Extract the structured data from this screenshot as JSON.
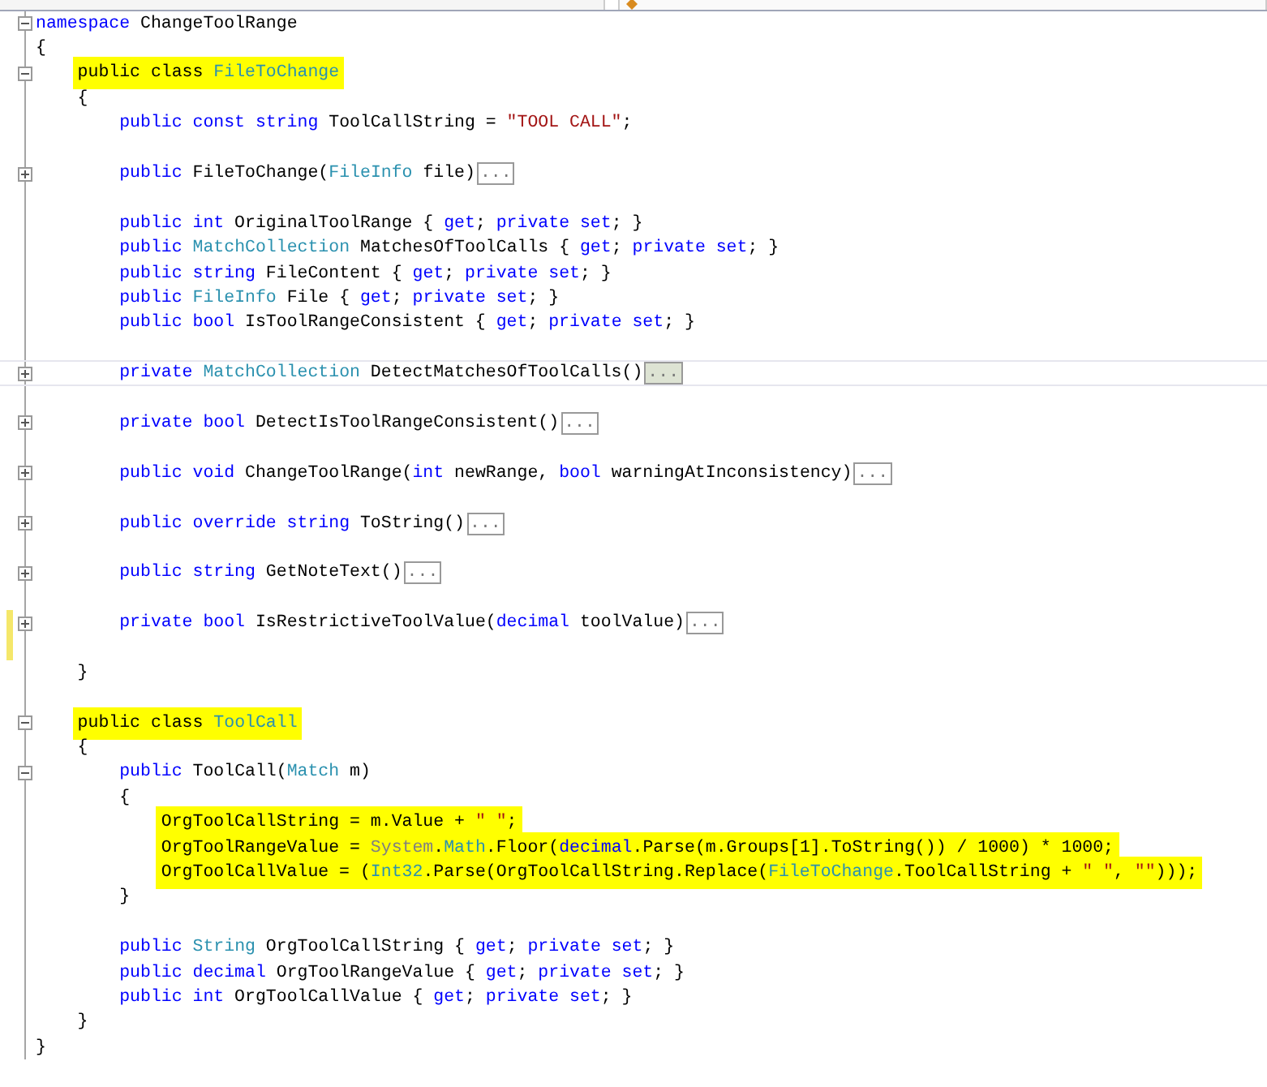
{
  "tabs": [
    {
      "selected": false
    },
    {
      "selected": true
    }
  ],
  "lines": [
    {
      "kind": "code",
      "expanded": true,
      "tokens": [
        {
          "kind": "keyword",
          "text": "namespace"
        },
        {
          "kind": "plain",
          "text": " ChangeToolRange"
        }
      ]
    },
    {
      "kind": "code",
      "tokens": [
        {
          "kind": "plain",
          "text": "{"
        }
      ],
      "children": [
        {
          "kind": "code",
          "expanded": true,
          "highlighted": true,
          "tokens": [
            {
              "kind": "plain",
              "text": "public class "
            },
            {
              "kind": "type",
              "text": "FileToChange"
            }
          ]
        },
        {
          "kind": "code",
          "tokens": [
            {
              "kind": "plain",
              "text": "{"
            }
          ],
          "children": [
            {
              "kind": "code",
              "tokens": [
                {
                  "kind": "keyword",
                  "text": "public const string"
                },
                {
                  "kind": "plain",
                  "text": " ToolCallString = "
                },
                {
                  "kind": "string",
                  "text": "\"TOOL CALL\""
                },
                {
                  "kind": "plain",
                  "text": ";"
                }
              ]
            },
            {
              "kind": "blank"
            },
            {
              "kind": "code",
              "expanded": false,
              "collapsed_text": "...",
              "tokens": [
                {
                  "kind": "keyword",
                  "text": "public"
                },
                {
                  "kind": "plain",
                  "text": " FileToChange("
                },
                {
                  "kind": "type",
                  "text": "FileInfo"
                },
                {
                  "kind": "plain",
                  "text": " file)"
                }
              ]
            },
            {
              "kind": "blank"
            },
            {
              "kind": "code",
              "tokens": [
                {
                  "kind": "keyword",
                  "text": "public int"
                },
                {
                  "kind": "plain",
                  "text": " OriginalToolRange { "
                },
                {
                  "kind": "keyword",
                  "text": "get"
                },
                {
                  "kind": "plain",
                  "text": "; "
                },
                {
                  "kind": "keyword",
                  "text": "private set"
                },
                {
                  "kind": "plain",
                  "text": "; }"
                }
              ]
            },
            {
              "kind": "code",
              "tokens": [
                {
                  "kind": "keyword",
                  "text": "public "
                },
                {
                  "kind": "type",
                  "text": "MatchCollection"
                },
                {
                  "kind": "plain",
                  "text": " MatchesOfToolCalls { "
                },
                {
                  "kind": "keyword",
                  "text": "get"
                },
                {
                  "kind": "plain",
                  "text": "; "
                },
                {
                  "kind": "keyword",
                  "text": "private set"
                },
                {
                  "kind": "plain",
                  "text": "; }"
                }
              ]
            },
            {
              "kind": "code",
              "tokens": [
                {
                  "kind": "keyword",
                  "text": "public string"
                },
                {
                  "kind": "plain",
                  "text": " FileContent { "
                },
                {
                  "kind": "keyword",
                  "text": "get"
                },
                {
                  "kind": "plain",
                  "text": "; "
                },
                {
                  "kind": "keyword",
                  "text": "private set"
                },
                {
                  "kind": "plain",
                  "text": "; }"
                }
              ]
            },
            {
              "kind": "code",
              "tokens": [
                {
                  "kind": "keyword",
                  "text": "public "
                },
                {
                  "kind": "type",
                  "text": "FileInfo"
                },
                {
                  "kind": "plain",
                  "text": " File { "
                },
                {
                  "kind": "keyword",
                  "text": "get"
                },
                {
                  "kind": "plain",
                  "text": "; "
                },
                {
                  "kind": "keyword",
                  "text": "private set"
                },
                {
                  "kind": "plain",
                  "text": "; }"
                }
              ]
            },
            {
              "kind": "code",
              "tokens": [
                {
                  "kind": "keyword",
                  "text": "public bool"
                },
                {
                  "kind": "plain",
                  "text": " IsToolRangeConsistent { "
                },
                {
                  "kind": "keyword",
                  "text": "get"
                },
                {
                  "kind": "plain",
                  "text": "; "
                },
                {
                  "kind": "keyword",
                  "text": "private set"
                },
                {
                  "kind": "plain",
                  "text": "; }"
                }
              ]
            },
            {
              "kind": "blank"
            },
            {
              "kind": "code",
              "expanded": false,
              "current": true,
              "collapsed_text": "...",
              "tokens": [
                {
                  "kind": "keyword",
                  "text": "private "
                },
                {
                  "kind": "type",
                  "text": "MatchCollection"
                },
                {
                  "kind": "plain",
                  "text": " DetectMatchesOfToolCalls()"
                }
              ]
            },
            {
              "kind": "blank"
            },
            {
              "kind": "code",
              "expanded": false,
              "collapsed_text": "...",
              "tokens": [
                {
                  "kind": "keyword",
                  "text": "private bool"
                },
                {
                  "kind": "plain",
                  "text": " DetectIsToolRangeConsistent()"
                }
              ]
            },
            {
              "kind": "blank"
            },
            {
              "kind": "code",
              "expanded": false,
              "collapsed_text": "...",
              "tokens": [
                {
                  "kind": "keyword",
                  "text": "public void"
                },
                {
                  "kind": "plain",
                  "text": " ChangeToolRange("
                },
                {
                  "kind": "keyword",
                  "text": "int"
                },
                {
                  "kind": "plain",
                  "text": " newRange, "
                },
                {
                  "kind": "keyword",
                  "text": "bool"
                },
                {
                  "kind": "plain",
                  "text": " warningAtInconsistency)"
                }
              ]
            },
            {
              "kind": "blank"
            },
            {
              "kind": "code",
              "expanded": false,
              "collapsed_text": "...",
              "tokens": [
                {
                  "kind": "keyword",
                  "text": "public override string"
                },
                {
                  "kind": "plain",
                  "text": " ToString()"
                }
              ]
            },
            {
              "kind": "blank"
            },
            {
              "kind": "code",
              "expanded": false,
              "collapsed_text": "...",
              "tokens": [
                {
                  "kind": "keyword",
                  "text": "public string"
                },
                {
                  "kind": "plain",
                  "text": " GetNoteText()"
                }
              ]
            },
            {
              "kind": "blank"
            },
            {
              "kind": "code",
              "expanded": false,
              "changed": true,
              "collapsed_text": "...",
              "tokens": [
                {
                  "kind": "keyword",
                  "text": "private bool"
                },
                {
                  "kind": "plain",
                  "text": " IsRestrictiveToolValue("
                },
                {
                  "kind": "keyword",
                  "text": "decimal"
                },
                {
                  "kind": "plain",
                  "text": " toolValue)"
                }
              ]
            },
            {
              "kind": "blank",
              "changed": true
            }
          ]
        },
        {
          "kind": "code",
          "tokens": [
            {
              "kind": "plain",
              "text": "}"
            }
          ]
        },
        {
          "kind": "blank"
        },
        {
          "kind": "code",
          "expanded": true,
          "highlighted": true,
          "tokens": [
            {
              "kind": "plain",
              "text": "public class "
            },
            {
              "kind": "type",
              "text": "ToolCall"
            }
          ]
        },
        {
          "kind": "code",
          "tokens": [
            {
              "kind": "plain",
              "text": "{"
            }
          ],
          "children": [
            {
              "kind": "code",
              "expanded": true,
              "tokens": [
                {
                  "kind": "keyword",
                  "text": "public"
                },
                {
                  "kind": "plain",
                  "text": " ToolCall("
                },
                {
                  "kind": "type",
                  "text": "Match"
                },
                {
                  "kind": "plain",
                  "text": " m)"
                }
              ]
            },
            {
              "kind": "code",
              "tokens": [
                {
                  "kind": "plain",
                  "text": "{"
                }
              ],
              "children": [
                {
                  "kind": "code",
                  "highlighted": true,
                  "tokens": [
                    {
                      "kind": "plain",
                      "text": "OrgToolCallString = m.Value + "
                    },
                    {
                      "kind": "string",
                      "text": "\" \""
                    },
                    {
                      "kind": "plain",
                      "text": ";"
                    }
                  ]
                },
                {
                  "kind": "code",
                  "highlighted": true,
                  "tokens": [
                    {
                      "kind": "plain",
                      "text": "OrgToolRangeValue = "
                    },
                    {
                      "kind": "dim",
                      "text": "System"
                    },
                    {
                      "kind": "plain",
                      "text": "."
                    },
                    {
                      "kind": "type",
                      "text": "Math"
                    },
                    {
                      "kind": "plain",
                      "text": ".Floor("
                    },
                    {
                      "kind": "keyword",
                      "text": "decimal"
                    },
                    {
                      "kind": "plain",
                      "text": ".Parse(m.Groups[1].ToString()) / 1000) * 1000;"
                    }
                  ]
                },
                {
                  "kind": "code",
                  "highlighted": true,
                  "tokens": [
                    {
                      "kind": "plain",
                      "text": "OrgToolCallValue = ("
                    },
                    {
                      "kind": "type",
                      "text": "Int32"
                    },
                    {
                      "kind": "plain",
                      "text": ".Parse(OrgToolCallString.Replace("
                    },
                    {
                      "kind": "type",
                      "text": "FileToChange"
                    },
                    {
                      "kind": "plain",
                      "text": ".ToolCallString + "
                    },
                    {
                      "kind": "string",
                      "text": "\" \""
                    },
                    {
                      "kind": "plain",
                      "text": ", "
                    },
                    {
                      "kind": "string",
                      "text": "\"\""
                    },
                    {
                      "kind": "plain",
                      "text": ")));"
                    }
                  ]
                }
              ]
            },
            {
              "kind": "code",
              "tokens": [
                {
                  "kind": "plain",
                  "text": "}"
                }
              ]
            },
            {
              "kind": "blank"
            },
            {
              "kind": "code",
              "tokens": [
                {
                  "kind": "keyword",
                  "text": "public "
                },
                {
                  "kind": "type",
                  "text": "String"
                },
                {
                  "kind": "plain",
                  "text": " OrgToolCallString { "
                },
                {
                  "kind": "keyword",
                  "text": "get"
                },
                {
                  "kind": "plain",
                  "text": "; "
                },
                {
                  "kind": "keyword",
                  "text": "private set"
                },
                {
                  "kind": "plain",
                  "text": "; }"
                }
              ]
            },
            {
              "kind": "code",
              "tokens": [
                {
                  "kind": "keyword",
                  "text": "public decimal"
                },
                {
                  "kind": "plain",
                  "text": " OrgToolRangeValue { "
                },
                {
                  "kind": "keyword",
                  "text": "get"
                },
                {
                  "kind": "plain",
                  "text": "; "
                },
                {
                  "kind": "keyword",
                  "text": "private set"
                },
                {
                  "kind": "plain",
                  "text": "; }"
                }
              ]
            },
            {
              "kind": "code",
              "tokens": [
                {
                  "kind": "keyword",
                  "text": "public int"
                },
                {
                  "kind": "plain",
                  "text": " OrgToolCallValue { "
                },
                {
                  "kind": "keyword",
                  "text": "get"
                },
                {
                  "kind": "plain",
                  "text": "; "
                },
                {
                  "kind": "keyword",
                  "text": "private set"
                },
                {
                  "kind": "plain",
                  "text": "; }"
                }
              ]
            }
          ]
        },
        {
          "kind": "code",
          "tokens": [
            {
              "kind": "plain",
              "text": "}"
            }
          ]
        }
      ]
    },
    {
      "kind": "code",
      "tokens": [
        {
          "kind": "plain",
          "text": "}"
        }
      ]
    }
  ]
}
